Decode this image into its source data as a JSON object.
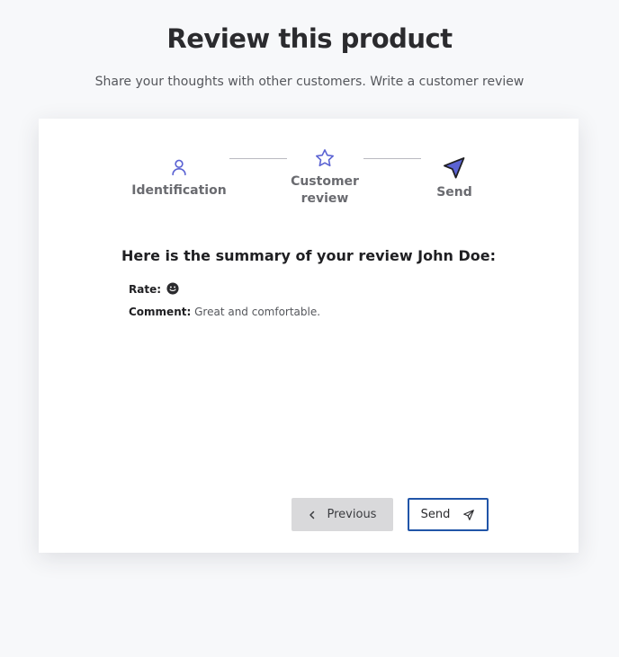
{
  "header": {
    "title": "Review this product",
    "subtitle": "Share your thoughts with other customers. Write a customer review"
  },
  "steps": [
    {
      "label": "Identification",
      "icon": "user-icon",
      "state": "completed"
    },
    {
      "label": "Customer review",
      "icon": "star-icon",
      "state": "completed"
    },
    {
      "label": "Send",
      "icon": "send-arrow-icon",
      "state": "active"
    }
  ],
  "summary": {
    "heading": "Here is the summary of your review John Doe:",
    "rate_label": "Rate:",
    "rate_icon": "smiley-icon",
    "comment_label": "Comment:",
    "comment_value": "Great and comfortable."
  },
  "buttons": {
    "previous_label": "Previous",
    "send_label": "Send"
  },
  "colors": {
    "accent": "#5b63d3",
    "send_border": "#2155a8",
    "previous_bg": "#d9d9db"
  }
}
